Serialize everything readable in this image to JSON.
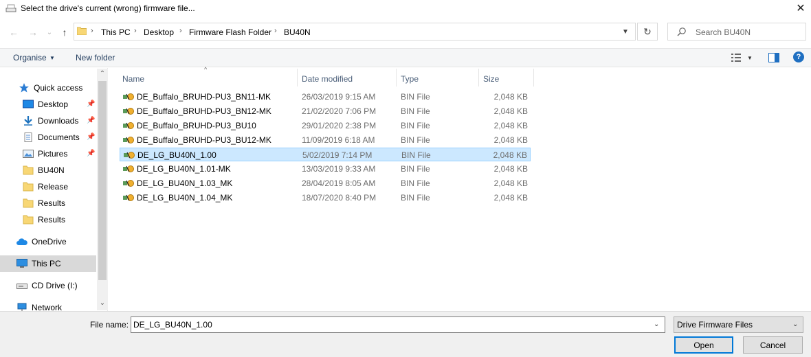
{
  "window": {
    "title": "Select the drive's current (wrong) firmware file...",
    "close_glyph": "✕"
  },
  "nav": {
    "back_glyph": "←",
    "forward_glyph": "→",
    "recent_glyph": "⌄",
    "up_glyph": "↑",
    "breadcrumbs": [
      "This PC",
      "Desktop",
      "Firmware Flash Folder",
      "BU40N"
    ],
    "separator": "›",
    "refresh_glyph": "↻",
    "search_placeholder": "Search BU40N"
  },
  "commandbar": {
    "organise_label": "Organise",
    "new_folder_label": "New folder",
    "help_label": "?"
  },
  "sidebar": {
    "items": [
      {
        "label": "Quick access",
        "icon": "star-icon"
      },
      {
        "label": "Desktop",
        "icon": "desktop-icon",
        "pinned": true
      },
      {
        "label": "Downloads",
        "icon": "download-icon",
        "pinned": true
      },
      {
        "label": "Documents",
        "icon": "documents-icon",
        "pinned": true
      },
      {
        "label": "Pictures",
        "icon": "pictures-icon",
        "pinned": true
      },
      {
        "label": "BU40N",
        "icon": "folder-icon"
      },
      {
        "label": "Release",
        "icon": "folder-icon"
      },
      {
        "label": "Results",
        "icon": "folder-icon"
      },
      {
        "label": "Results",
        "icon": "folder-icon"
      },
      {
        "label": "OneDrive",
        "icon": "cloud-icon"
      },
      {
        "label": "This PC",
        "icon": "computer-icon",
        "selected": true
      },
      {
        "label": "CD Drive (I:)",
        "icon": "cd-drive-icon"
      },
      {
        "label": "Network",
        "icon": "network-icon"
      }
    ]
  },
  "filelist": {
    "columns": [
      "Name",
      "Date modified",
      "Type",
      "Size"
    ],
    "rows": [
      {
        "name": "DE_Buffalo_BRUHD-PU3_BN11-MK",
        "date": "26/03/2019 9:15 AM",
        "type": "BIN File",
        "size": "2,048 KB"
      },
      {
        "name": "DE_Buffalo_BRUHD-PU3_BN12-MK",
        "date": "21/02/2020 7:06 PM",
        "type": "BIN File",
        "size": "2,048 KB"
      },
      {
        "name": "DE_Buffalo_BRUHD-PU3_BU10",
        "date": "29/01/2020 2:38 PM",
        "type": "BIN File",
        "size": "2,048 KB"
      },
      {
        "name": "DE_Buffalo_BRUHD-PU3_BU12-MK",
        "date": "11/09/2019 6:18 AM",
        "type": "BIN File",
        "size": "2,048 KB"
      },
      {
        "name": "DE_LG_BU40N_1.00",
        "date": "5/02/2019 7:14 PM",
        "type": "BIN File",
        "size": "2,048 KB",
        "selected": true
      },
      {
        "name": "DE_LG_BU40N_1.01-MK",
        "date": "13/03/2019 9:33 AM",
        "type": "BIN File",
        "size": "2,048 KB"
      },
      {
        "name": "DE_LG_BU40N_1.03_MK",
        "date": "28/04/2019 8:05 AM",
        "type": "BIN File",
        "size": "2,048 KB"
      },
      {
        "name": "DE_LG_BU40N_1.04_MK",
        "date": "18/07/2020 8:40 PM",
        "type": "BIN File",
        "size": "2,048 KB"
      }
    ]
  },
  "footer": {
    "file_name_label": "File name:",
    "file_name_value": "DE_LG_BU40N_1.00",
    "file_type_value": "Drive Firmware Files",
    "open_label": "Open",
    "cancel_label": "Cancel"
  },
  "colors": {
    "selection_bg": "#cce8ff",
    "selection_border": "#99d1ff",
    "link_blue": "#1e395b",
    "accent": "#0078d7"
  }
}
